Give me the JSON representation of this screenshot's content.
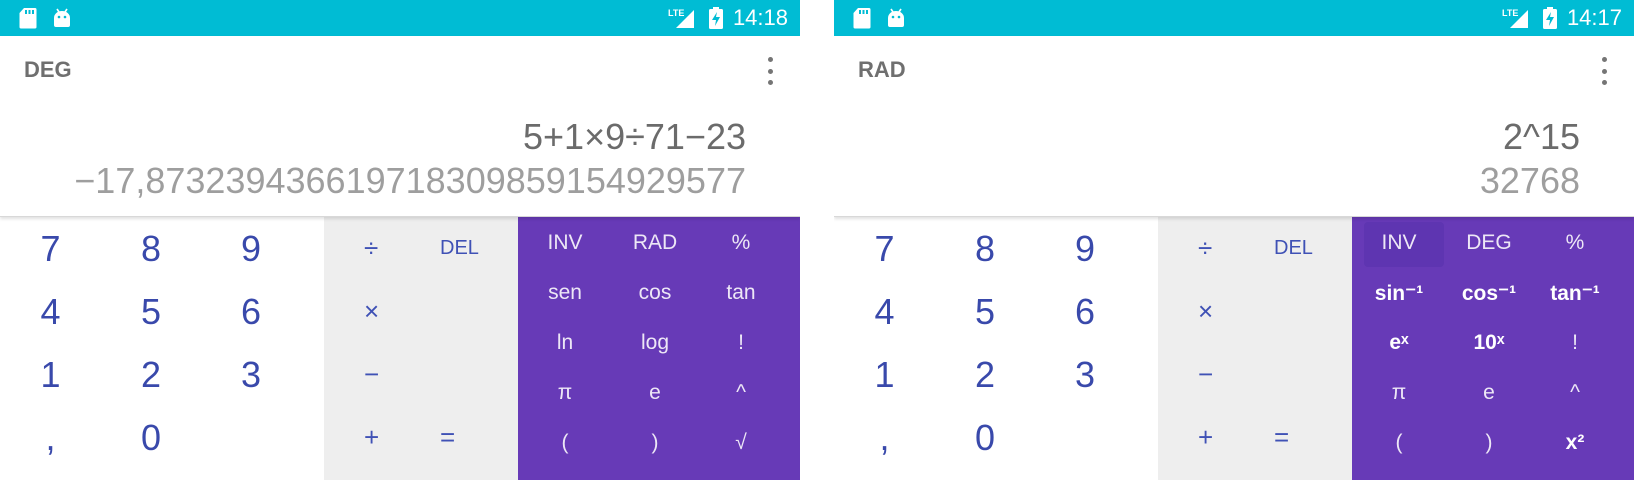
{
  "colors": {
    "status_bar": "#00bcd4",
    "advanced_pad": "#673ab7",
    "ops_pad": "#eeeeee",
    "digit_text": "#3949ab"
  },
  "icons": [
    "sd-card-icon",
    "android-icon",
    "lte-signal-icon",
    "battery-charging-icon",
    "overflow-menu-icon"
  ],
  "screens": [
    {
      "status_bar": {
        "network": "LTE",
        "time": "14:18"
      },
      "mode_label": "DEG",
      "formula": "5+1×9÷71−23",
      "result": "−17,873239436619718309859154929577",
      "numbers": [
        [
          "7",
          "8",
          "9"
        ],
        [
          "4",
          "5",
          "6"
        ],
        [
          "1",
          "2",
          "3"
        ],
        [
          ",",
          "0",
          ""
        ]
      ],
      "ops": {
        "divide": "÷",
        "del": "DEL",
        "times": "×",
        "minus": "−",
        "plus": "+",
        "equals": "="
      },
      "advanced": [
        [
          "INV",
          "RAD",
          "%"
        ],
        [
          "sen",
          "cos",
          "tan"
        ],
        [
          "ln",
          "log",
          "!"
        ],
        [
          "π",
          "e",
          "^"
        ],
        [
          "(",
          ")",
          "√"
        ]
      ]
    },
    {
      "status_bar": {
        "network": "LTE",
        "time": "14:17"
      },
      "mode_label": "RAD",
      "formula": "2^15",
      "result": "32768",
      "numbers": [
        [
          "7",
          "8",
          "9"
        ],
        [
          "4",
          "5",
          "6"
        ],
        [
          "1",
          "2",
          "3"
        ],
        [
          ",",
          "0",
          ""
        ]
      ],
      "ops": {
        "divide": "÷",
        "del": "DEL",
        "times": "×",
        "minus": "−",
        "plus": "+",
        "equals": "="
      },
      "advanced": [
        [
          "INV",
          "DEG",
          "%"
        ],
        [
          "sin⁻¹",
          "cos⁻¹",
          "tan⁻¹"
        ],
        [
          "eˣ",
          "10ˣ",
          "!"
        ],
        [
          "π",
          "e",
          "^"
        ],
        [
          "(",
          ")",
          "x²"
        ]
      ]
    }
  ]
}
